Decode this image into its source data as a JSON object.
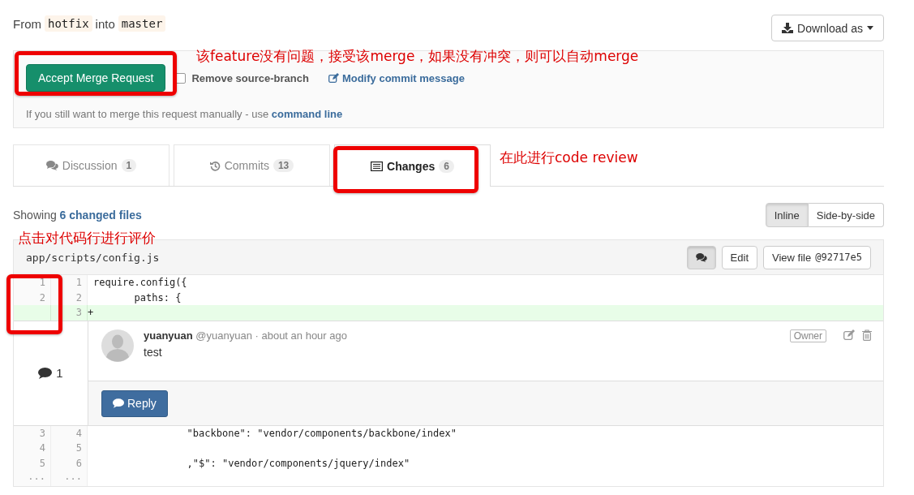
{
  "header": {
    "from_label": "From",
    "source_branch": "hotfix",
    "into_label": "into",
    "target_branch": "master",
    "download_button": "Download as"
  },
  "merge_box": {
    "accept_button": "Accept Merge Request",
    "remove_source_branch": {
      "label": "Remove source-branch",
      "checked": false
    },
    "modify_link": "Modify commit message",
    "manual_text": "If you still want to merge this request manually - use",
    "manual_link": "command line"
  },
  "tabs": [
    {
      "kind": "discussion",
      "label": "Discussion",
      "count": "1",
      "selected": false
    },
    {
      "kind": "commits",
      "label": "Commits",
      "count": "13",
      "selected": false
    },
    {
      "kind": "changes",
      "label": "Changes",
      "count": "6",
      "selected": true
    }
  ],
  "summary": {
    "prefix": "Showing",
    "link": "6 changed files"
  },
  "view_toggle": [
    {
      "label": "Inline",
      "selected": true
    },
    {
      "label": "Side-by-side",
      "selected": false
    }
  ],
  "file": {
    "path": "app/scripts/config.js",
    "comments_shown": true,
    "edit_button": "Edit",
    "view_button": "View file",
    "commit": "@92717e5",
    "lines": [
      {
        "kind": "context",
        "old": "1",
        "new": "1",
        "code": "require.config({"
      },
      {
        "kind": "context",
        "old": "2",
        "new": "2",
        "code": "       paths: {"
      },
      {
        "kind": "added",
        "new": "3",
        "code": "+"
      }
    ],
    "discussion": {
      "count": "1",
      "author": "yuanyuan",
      "meta": "@yuanyuan · about an hour ago",
      "role": "Owner",
      "body": "test",
      "reply_button": "Reply"
    },
    "lines_after": [
      {
        "kind": "context",
        "old": "3",
        "new": "4",
        "code": "                \"backbone\": \"vendor/components/backbone/index\""
      },
      {
        "kind": "context",
        "old": "4",
        "new": "5"
      },
      {
        "kind": "context",
        "old": "5",
        "new": "6",
        "code": "                ,\"$\": \"vendor/components/jquery/index\""
      },
      {
        "kind": "expander",
        "old": "...",
        "new": "..."
      }
    ]
  },
  "annotations": [
    {
      "text": "该feature没有问题，接受该merge，如果没有冲突，则可以自动merge"
    },
    {
      "text": "在此进行code review"
    },
    {
      "text": "点击对代码行进行评价"
    }
  ]
}
